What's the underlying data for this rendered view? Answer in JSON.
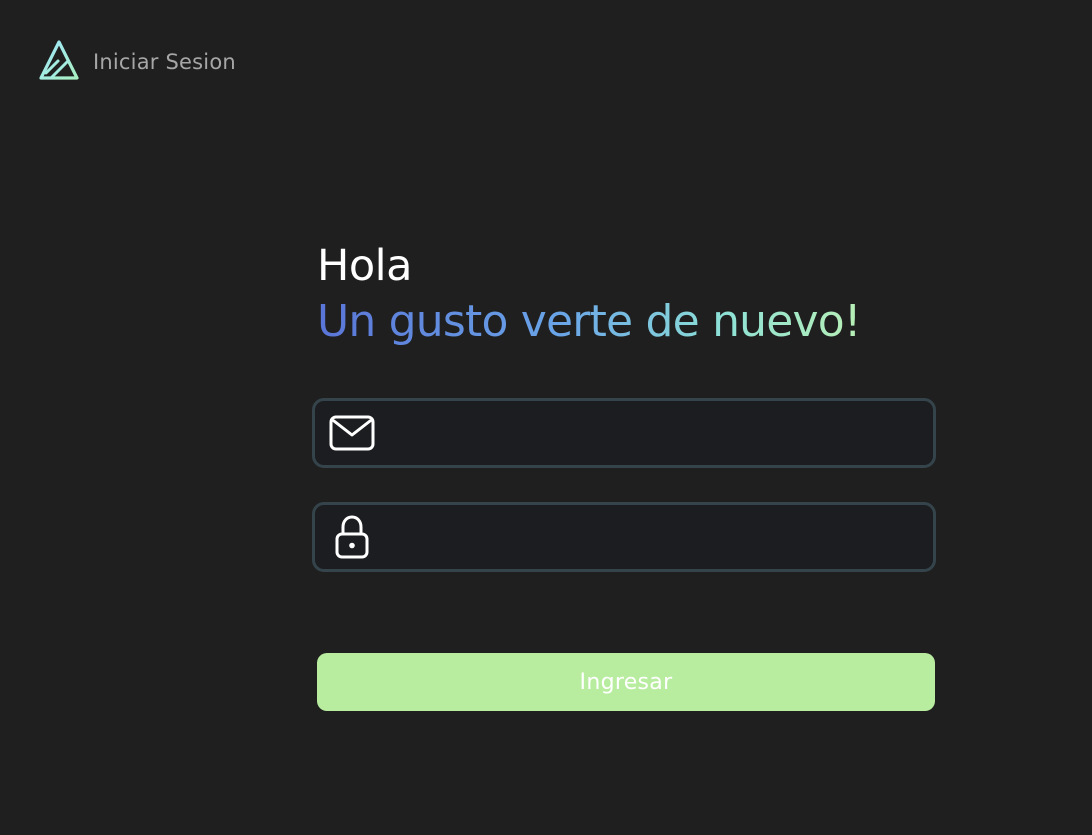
{
  "brand": {
    "title": "Iniciar Sesion",
    "icon": "triangle-logo-icon",
    "gradient": [
      "#9fe6ff",
      "#a8f0c0"
    ]
  },
  "login": {
    "greeting": "Hola",
    "tagline": "Un gusto verte de nuevo!",
    "email": {
      "icon": "mail-icon",
      "value": "",
      "placeholder": ""
    },
    "password": {
      "icon": "lock-icon",
      "value": "",
      "placeholder": ""
    },
    "submit_label": "Ingresar"
  },
  "colors": {
    "background": "#1f1f1f",
    "field_background": "#1b1d20",
    "field_border": "#35444b",
    "button": "#b8ed9f",
    "tagline_gradient": [
      "#5a75d8",
      "#6aa5e8",
      "#8ee2d6",
      "#b8efb5"
    ]
  }
}
